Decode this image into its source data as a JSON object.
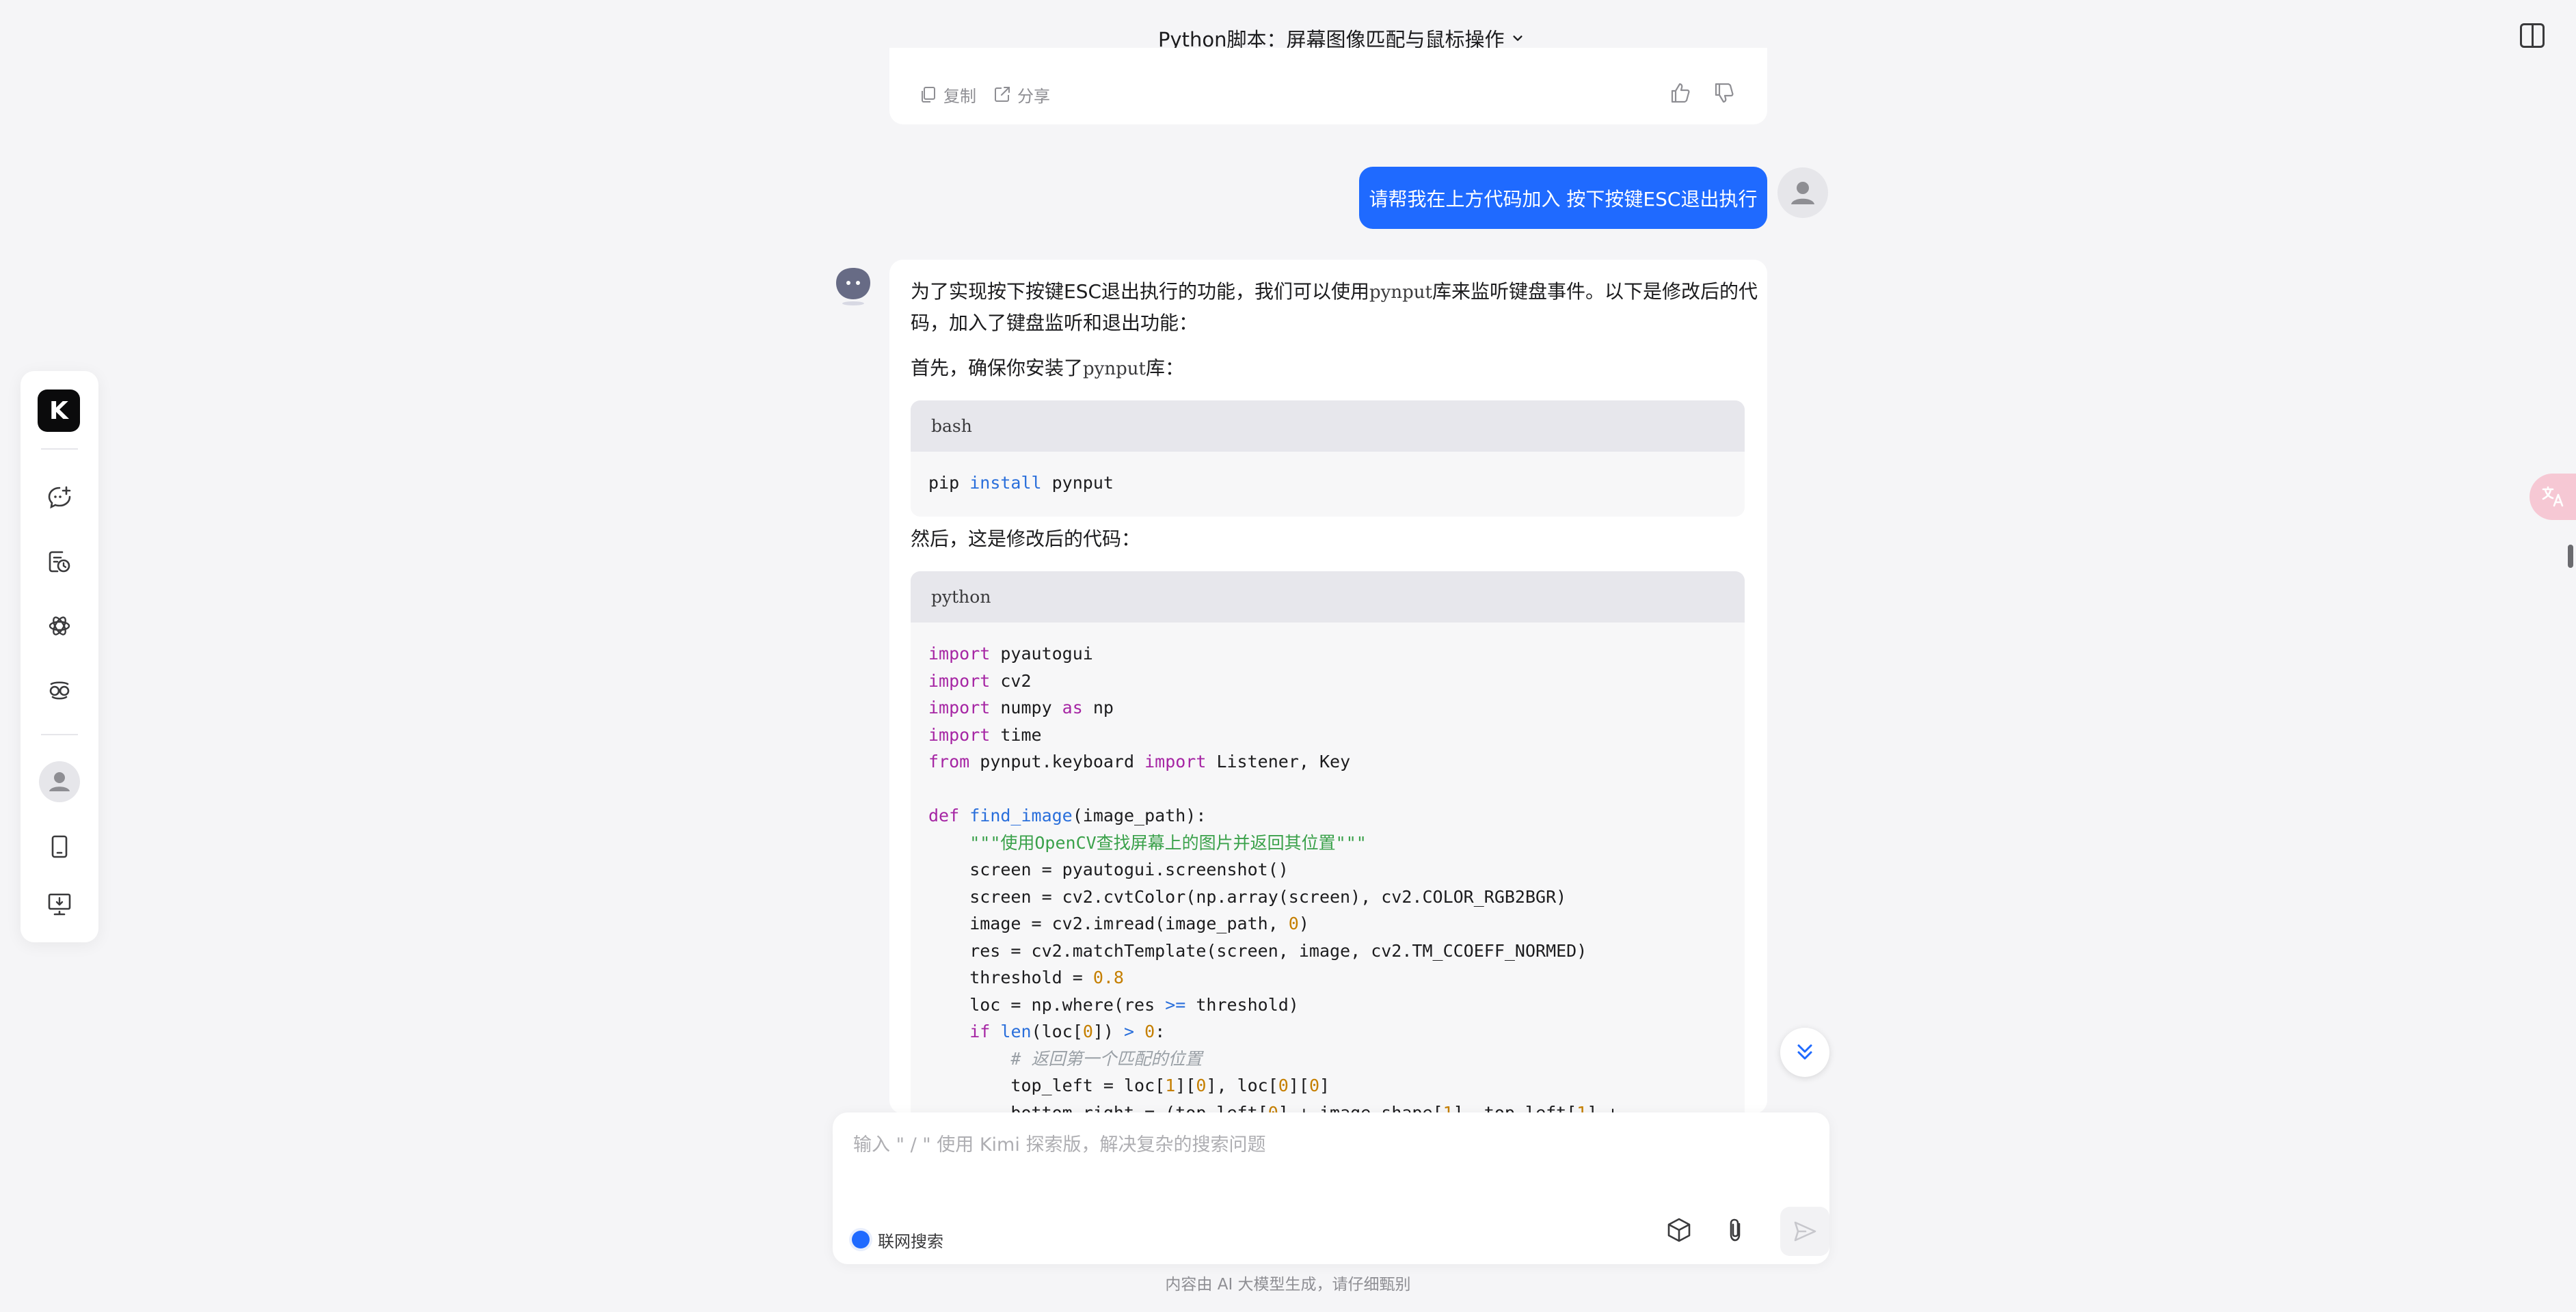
{
  "header": {
    "title": "Python脚本：屏幕图像匹配与鼠标操作"
  },
  "rail": {
    "logo_text": "K",
    "items": [
      {
        "icon": "new-chat-icon"
      },
      {
        "icon": "history-icon"
      },
      {
        "icon": "explore-icon"
      },
      {
        "icon": "kimi-plus-icon"
      },
      {
        "icon": "user-avatar"
      },
      {
        "icon": "mobile-app-icon"
      },
      {
        "icon": "desktop-app-icon"
      }
    ]
  },
  "previous_message": {
    "copy_label": "复制",
    "share_label": "分享"
  },
  "user_message": {
    "text": "请帮我在上方代码加入 按下按键ESC退出执行"
  },
  "assistant_message": {
    "intro_a": "为了实现按下按键ESC退出执行的功能，我们可以使用",
    "intro_lib": "pynput",
    "intro_b": "库来监听键盘事件。以下是修改后的代",
    "intro_c": "码，加入了键盘监听和退出功能：",
    "install_a": "首先，确保你安装了",
    "install_lib": "pynput",
    "install_b": "库：",
    "bash_lang": "bash",
    "then_text": "然后，这是修改后的代码：",
    "python_lang": "python"
  },
  "composer": {
    "placeholder": "输入 \" / \" 使用 Kimi 探索版，解决复杂的搜索问题",
    "web_search_label": "联网搜索"
  },
  "footer": {
    "disclaimer": "内容由 AI 大模型生成，请仔细甄别"
  },
  "colors": {
    "accent": "#1f6aff",
    "background": "#f5f5f7",
    "card": "#ffffff",
    "code_header": "#e7e7ec",
    "code_bg": "#f7f7f8"
  }
}
